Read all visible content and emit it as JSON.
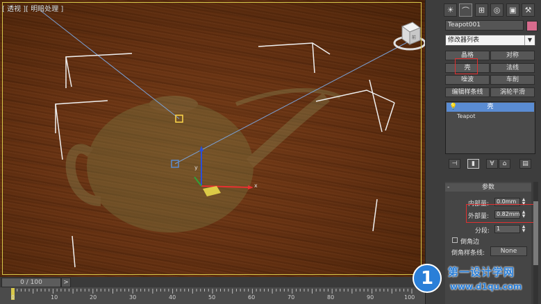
{
  "viewport": {
    "label": "[ 透视 ][ 明暗处理 ]",
    "colors": {
      "border": "#d7c84a",
      "wood": "#6a3312",
      "bracket": "#f0f0f0",
      "line": "#7aa2d8"
    }
  },
  "command_panel": {
    "tab_icons": [
      "sun-icon",
      "modify-icon",
      "hierarchy-icon",
      "motion-icon",
      "display-icon",
      "utilities-icon"
    ],
    "object_name": "Teapot001",
    "object_color": "#d76b8d",
    "modifier_list_label": "修改器列表",
    "modifier_buttons": [
      "晶格",
      "对称",
      "壳",
      "法线",
      "噪波",
      "车削",
      "编辑样条线",
      "涡轮平滑"
    ],
    "stack": {
      "shell": "壳",
      "teapot": "Teapot"
    },
    "stack_tools": [
      "pin-stack-icon",
      "show-end-result-icon",
      "make-unique-icon",
      "remove-modifier-icon",
      "configure-sets-icon"
    ]
  },
  "parameters": {
    "header": "参数",
    "inner_label": "内部量:",
    "inner_value": "0.0mm",
    "outer_label": "外部量:",
    "outer_value": "0.82mm",
    "segments_label": "分段:",
    "segments_value": "1",
    "chamfer_edges_label": "倒角边",
    "chamfer_spline_label": "倒角样条线:",
    "chamfer_spline_button": "None"
  },
  "timeline": {
    "frame_display": "0 / 100",
    "next_label": ">",
    "ticks": [
      "0",
      "10",
      "20",
      "30",
      "40",
      "50",
      "60",
      "70",
      "80",
      "90",
      "100"
    ]
  },
  "watermark": {
    "logo_text": "1",
    "title": "第一设计学网",
    "url": "www.d1qu.com"
  }
}
